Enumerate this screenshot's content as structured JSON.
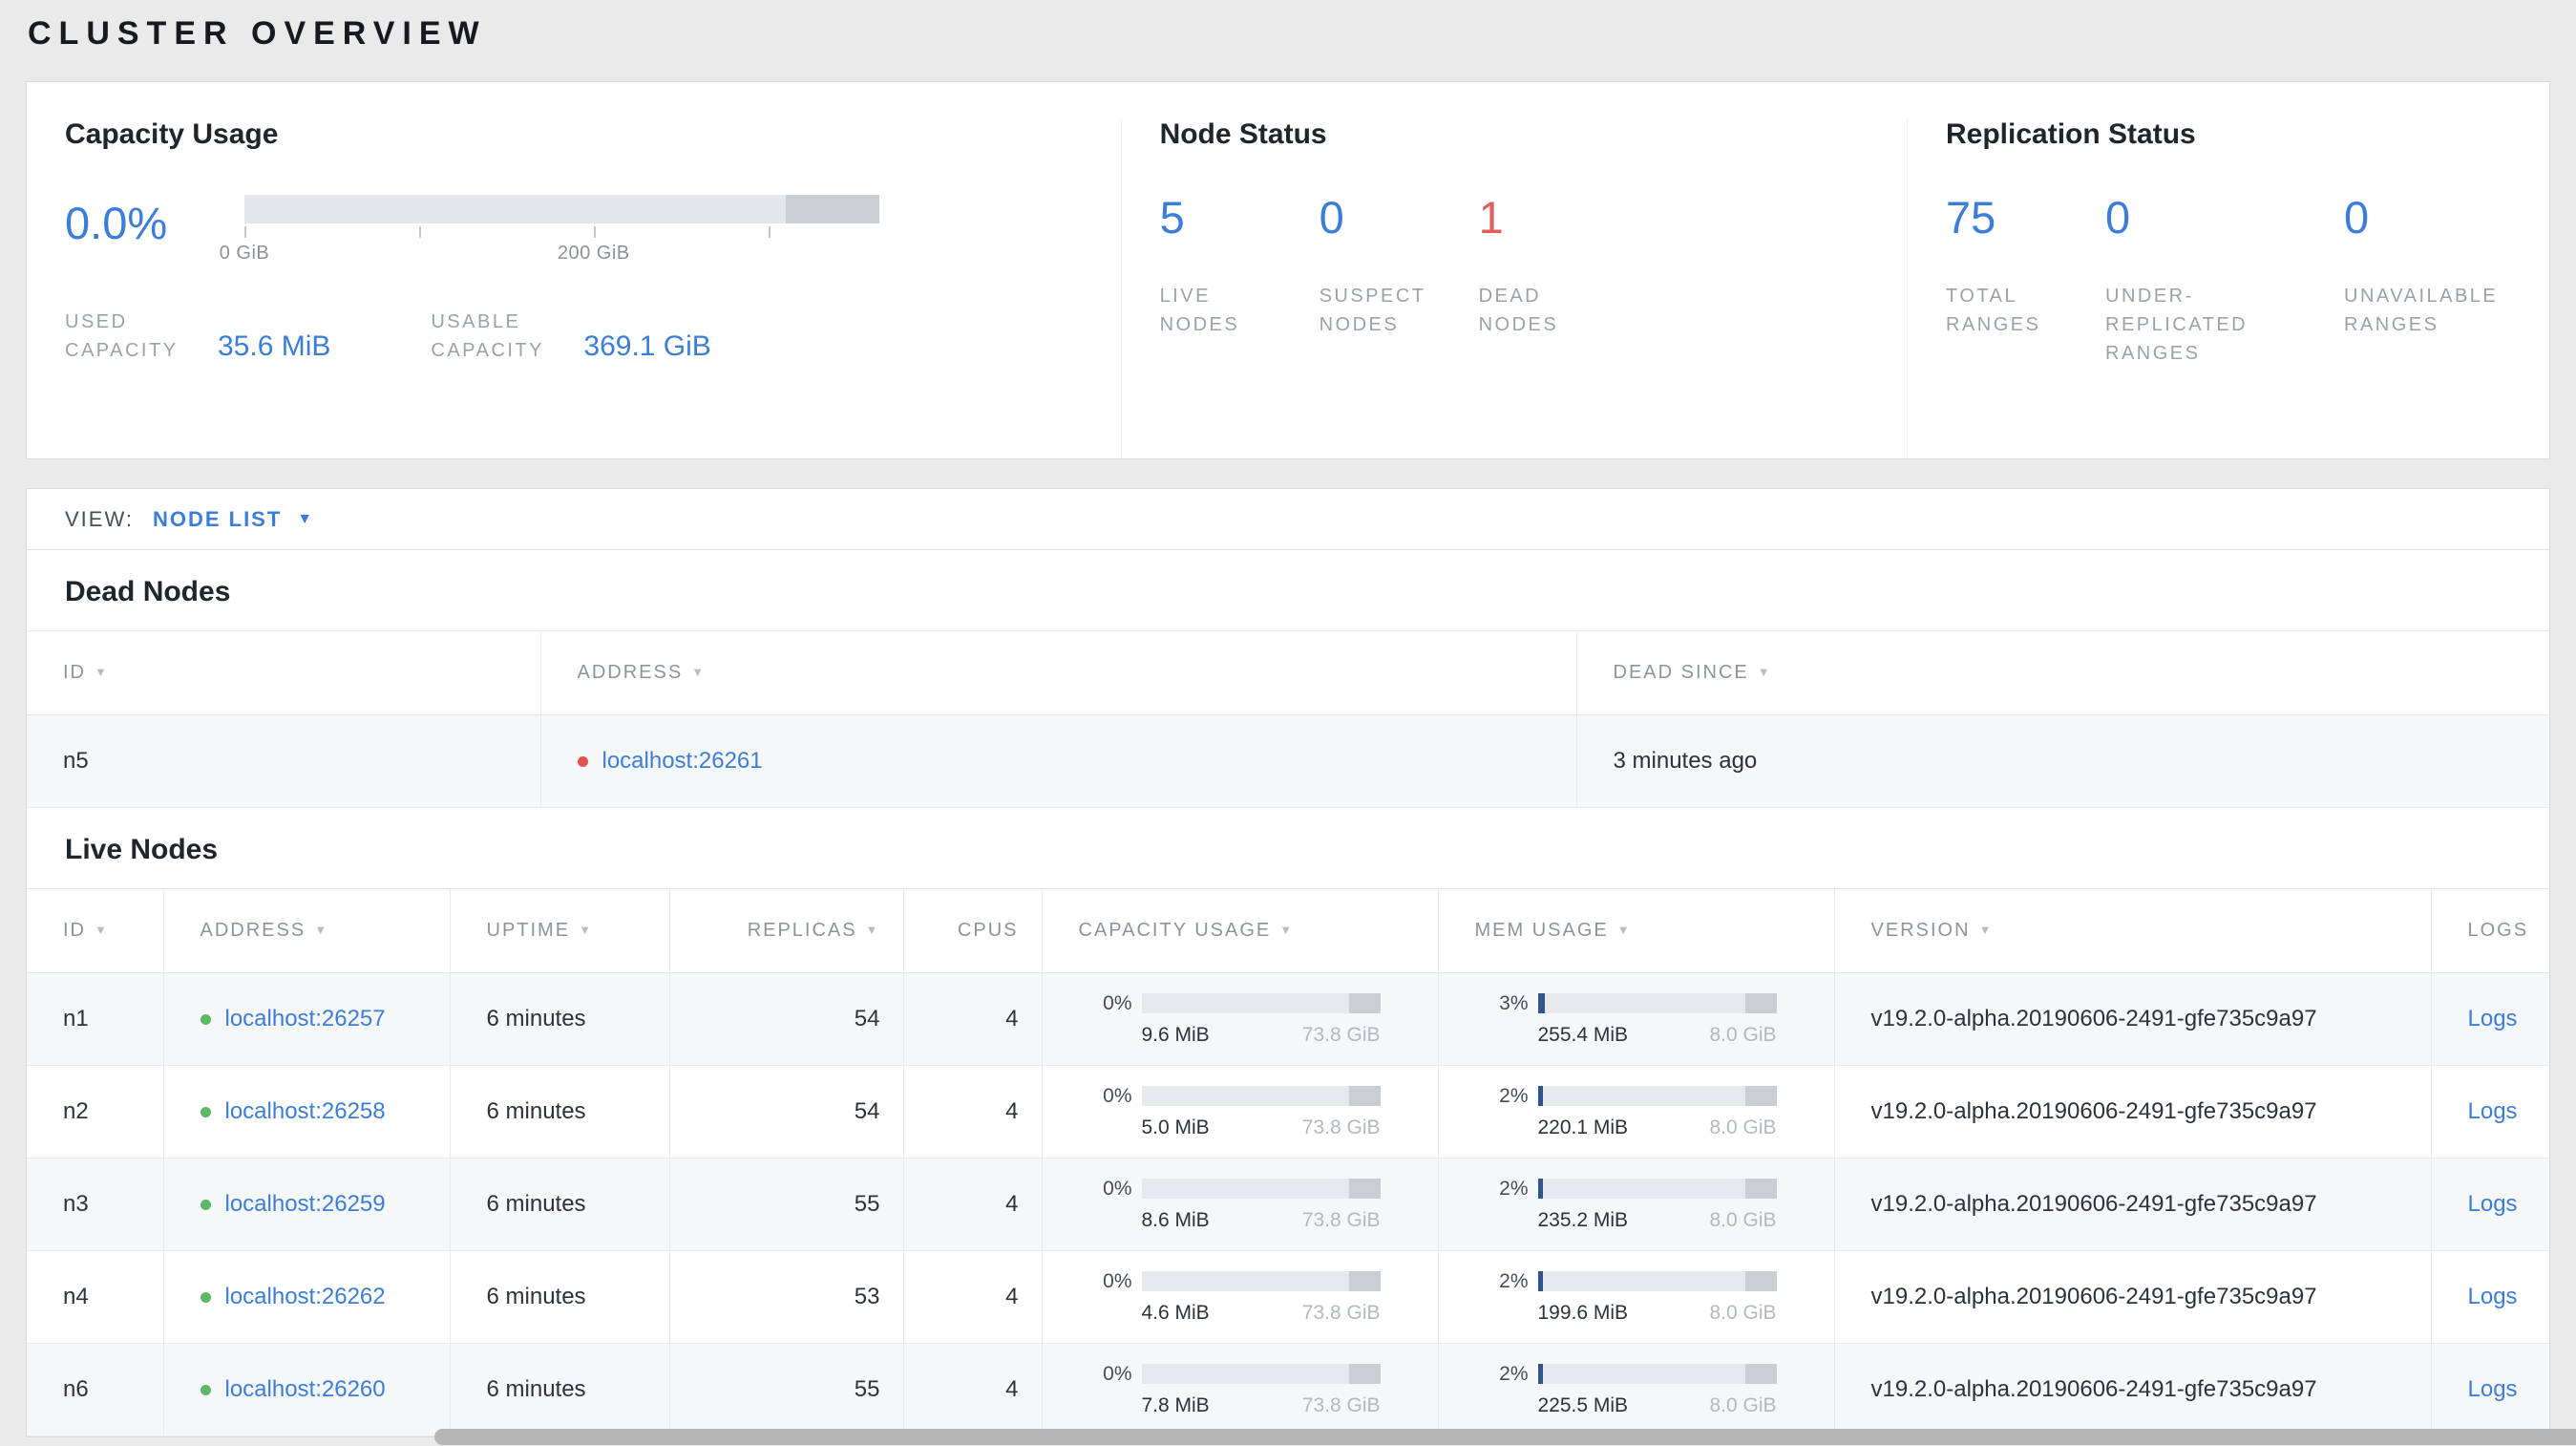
{
  "page_title": "CLUSTER OVERVIEW",
  "icons": {
    "sort_arrow": "▼",
    "caret_down": "▼"
  },
  "colors": {
    "accent_blue": "#3b7dd9",
    "danger_red": "#e1605f",
    "live_green": "#5cb768",
    "dead_red": "#e1544e"
  },
  "summary": {
    "capacity": {
      "title": "Capacity Usage",
      "percent": "0.0%",
      "bar": {
        "used_pct": 0,
        "secondary_pct": 14.8,
        "ticks": [
          {
            "pct": 0,
            "label": "0 GiB"
          },
          {
            "pct": 27.5,
            "label": ""
          },
          {
            "pct": 55,
            "label": "200 GiB"
          },
          {
            "pct": 82.5,
            "label": ""
          }
        ]
      },
      "stats": [
        {
          "label": "USED CAPACITY",
          "value": "35.6 MiB"
        },
        {
          "label": "USABLE CAPACITY",
          "value": "369.1 GiB"
        }
      ]
    },
    "node_status": {
      "title": "Node Status",
      "items": [
        {
          "value": "5",
          "label": "LIVE NODES"
        },
        {
          "value": "0",
          "label": "SUSPECT NODES"
        },
        {
          "value": "1",
          "label": "DEAD NODES"
        }
      ]
    },
    "replication": {
      "title": "Replication Status",
      "items": [
        {
          "value": "75",
          "label": "TOTAL RANGES"
        },
        {
          "value": "0",
          "label": "UNDER-REPLICATED RANGES"
        },
        {
          "value": "0",
          "label": "UNAVAILABLE RANGES"
        }
      ]
    }
  },
  "view_bar": {
    "label": "VIEW:",
    "selected": "NODE LIST"
  },
  "dead_nodes": {
    "title": "Dead Nodes",
    "columns": [
      "ID",
      "ADDRESS",
      "DEAD SINCE"
    ],
    "rows": [
      {
        "id": "n5",
        "address": "localhost:26261",
        "dead_since": "3 minutes ago"
      }
    ]
  },
  "live_nodes": {
    "title": "Live Nodes",
    "columns": [
      "ID",
      "ADDRESS",
      "UPTIME",
      "REPLICAS",
      "CPUS",
      "CAPACITY USAGE",
      "MEM USAGE",
      "VERSION",
      "LOGS"
    ],
    "rows": [
      {
        "id": "n1",
        "address": "localhost:26257",
        "uptime": "6 minutes",
        "replicas": "54",
        "cpus": "4",
        "capacity_pct": "0%",
        "capacity_fill": 0,
        "capacity_used": "9.6 MiB",
        "capacity_total": "73.8 GiB",
        "mem_pct": "3%",
        "mem_fill": 3,
        "mem_used": "255.4 MiB",
        "mem_total": "8.0 GiB",
        "version": "v19.2.0-alpha.20190606-2491-gfe735c9a97",
        "logs": "Logs"
      },
      {
        "id": "n2",
        "address": "localhost:26258",
        "uptime": "6 minutes",
        "replicas": "54",
        "cpus": "4",
        "capacity_pct": "0%",
        "capacity_fill": 0,
        "capacity_used": "5.0 MiB",
        "capacity_total": "73.8 GiB",
        "mem_pct": "2%",
        "mem_fill": 2,
        "mem_used": "220.1 MiB",
        "mem_total": "8.0 GiB",
        "version": "v19.2.0-alpha.20190606-2491-gfe735c9a97",
        "logs": "Logs"
      },
      {
        "id": "n3",
        "address": "localhost:26259",
        "uptime": "6 minutes",
        "replicas": "55",
        "cpus": "4",
        "capacity_pct": "0%",
        "capacity_fill": 0,
        "capacity_used": "8.6 MiB",
        "capacity_total": "73.8 GiB",
        "mem_pct": "2%",
        "mem_fill": 2,
        "mem_used": "235.2 MiB",
        "mem_total": "8.0 GiB",
        "version": "v19.2.0-alpha.20190606-2491-gfe735c9a97",
        "logs": "Logs"
      },
      {
        "id": "n4",
        "address": "localhost:26262",
        "uptime": "6 minutes",
        "replicas": "53",
        "cpus": "4",
        "capacity_pct": "0%",
        "capacity_fill": 0,
        "capacity_used": "4.6 MiB",
        "capacity_total": "73.8 GiB",
        "mem_pct": "2%",
        "mem_fill": 2,
        "mem_used": "199.6 MiB",
        "mem_total": "8.0 GiB",
        "version": "v19.2.0-alpha.20190606-2491-gfe735c9a97",
        "logs": "Logs"
      },
      {
        "id": "n6",
        "address": "localhost:26260",
        "uptime": "6 minutes",
        "replicas": "55",
        "cpus": "4",
        "capacity_pct": "0%",
        "capacity_fill": 0,
        "capacity_used": "7.8 MiB",
        "capacity_total": "73.8 GiB",
        "mem_pct": "2%",
        "mem_fill": 2,
        "mem_used": "225.5 MiB",
        "mem_total": "8.0 GiB",
        "version": "v19.2.0-alpha.20190606-2491-gfe735c9a97",
        "logs": "Logs"
      }
    ]
  }
}
